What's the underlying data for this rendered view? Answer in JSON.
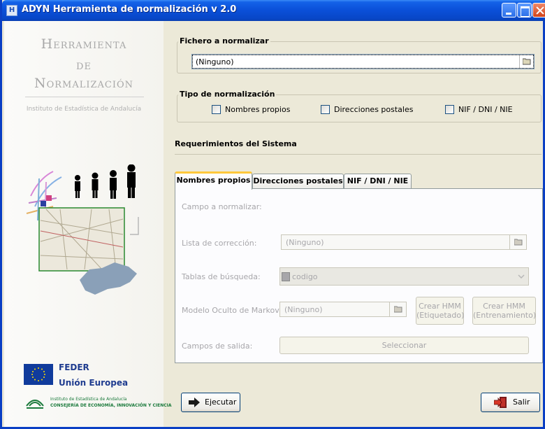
{
  "window": {
    "title": "ADYN Herramienta de normalización v 2.0"
  },
  "branding": {
    "line1": "Herramienta",
    "line2": "de",
    "line3": "Normalización",
    "subtitle": "Instituto de Estadística de Andalucía",
    "feder_line1": "FEDER",
    "feder_line2": "Unión Europea",
    "junta_line1": "Instituto de Estadística de Andalucía",
    "junta_line2": "CONSEJERÍA DE ECONOMÍA, INNOVACIÓN Y CIENCIA"
  },
  "file_group": {
    "title": "Fichero  a normalizar",
    "value": "(Ninguno)"
  },
  "type_group": {
    "title": "Tipo de normalización",
    "options": [
      {
        "label": "Nombres propios",
        "checked": false
      },
      {
        "label": "Direcciones postales",
        "checked": false
      },
      {
        "label": "NIF / DNI / NIE",
        "checked": false
      }
    ]
  },
  "requirements": {
    "title": "Requerimientos del Sistema",
    "tabs": [
      "Nombres propios",
      "Direcciones postales",
      "NIF / DNI / NIE"
    ],
    "active_tab": 0,
    "field_label": "Campo a normalizar:",
    "correction_label": "Lista de corrección:",
    "correction_value": "(Ninguno)",
    "lookup_label": "Tablas de búsqueda:",
    "lookup_value": "codigo",
    "markov_label": "Modelo Oculto de Markov:",
    "markov_value": "(Ninguno)",
    "hmm_tagged_line1": "Crear HMM",
    "hmm_tagged_line2": "(Etiquetado)",
    "hmm_train_line1": "Crear HMM",
    "hmm_train_line2": "(Entrenamiento)",
    "output_label": "Campos de salida:",
    "select_label": "Seleccionar"
  },
  "actions": {
    "run_label": "Ejecutar",
    "exit_label": "Salir"
  },
  "colors": {
    "titlebar": "#0a4fd8",
    "tab_highlight": "#ffc83c",
    "disabled_text": "#a7a6aa",
    "brand_text": "#1f3c8f"
  }
}
